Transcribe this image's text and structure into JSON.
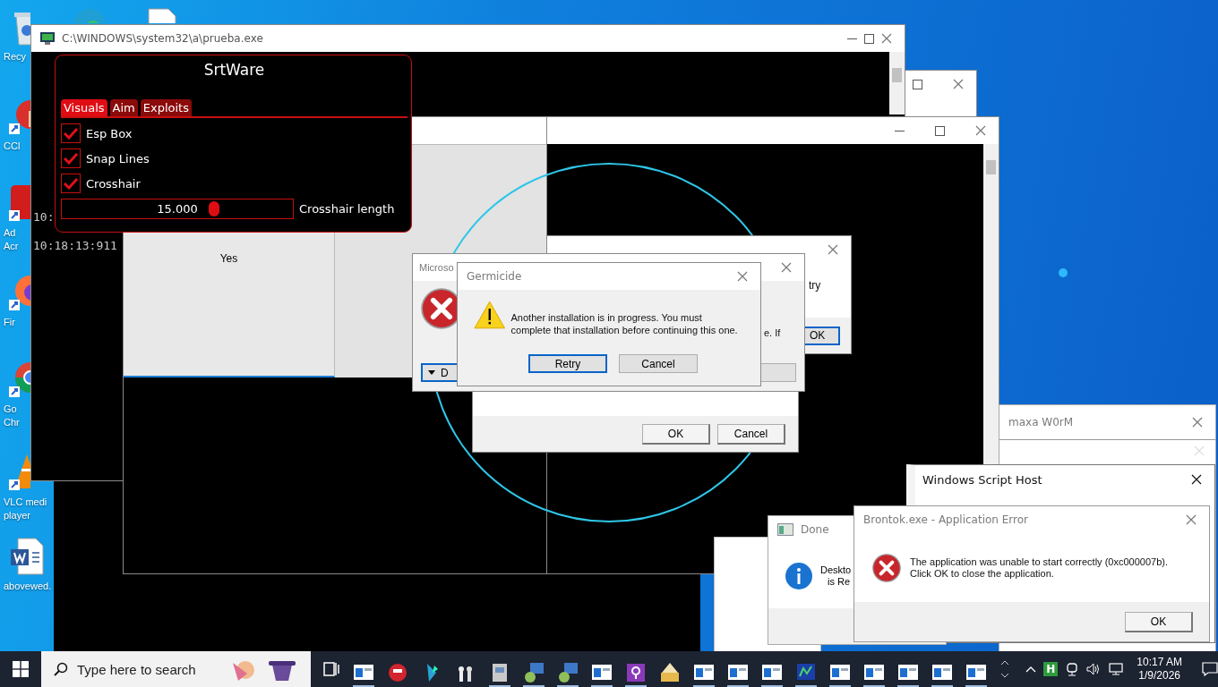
{
  "desktop_icons": [
    {
      "kind": "recycle",
      "lines": [
        "Recy"
      ]
    },
    {
      "kind": "edge"
    },
    {
      "kind": "document"
    },
    {
      "kind": "cleaner",
      "lines": [
        "CCl"
      ]
    },
    {
      "kind": "acrobat",
      "lines": [
        "Ad",
        "Acr"
      ]
    },
    {
      "kind": "firefox",
      "lines": [
        "Fir"
      ]
    },
    {
      "kind": "chrome",
      "lines": [
        "Go",
        "Chr"
      ]
    },
    {
      "kind": "vlc",
      "lines": [
        "VLC medi",
        "player"
      ]
    },
    {
      "kind": "word",
      "lines": [
        "abovewed."
      ]
    }
  ],
  "console": {
    "title": "C:\\WINDOWS\\system32\\a\\prueba.exe",
    "lines": [
      "10:",
      "10:18:13:911"
    ]
  },
  "srtware": {
    "title": "SrtWare",
    "tabs": [
      {
        "label": "Visuals",
        "selected": true
      },
      {
        "label": "Aim",
        "selected": false
      },
      {
        "label": "Exploits",
        "selected": false
      }
    ],
    "options": [
      {
        "label": "Esp Box",
        "checked": true
      },
      {
        "label": "Snap Lines",
        "checked": true
      },
      {
        "label": "Crosshair",
        "checked": true
      }
    ],
    "slider": {
      "value": "15.000",
      "level": 0.66,
      "label": "Crosshair length"
    }
  },
  "yes_window": {
    "button": "Yes"
  },
  "back_dialog": {
    "text_1": "try",
    "button": "OK"
  },
  "lower_dialog": {
    "buttons": [
      "OK",
      "Cancel"
    ]
  },
  "microsoft_dialog": {
    "title": "Microso",
    "text": "e. If",
    "dropdown": "D"
  },
  "germicide": {
    "title": "Germicide",
    "message": "Another installation is in progress. You must complete that installation before continuing this one.",
    "buttons": [
      {
        "label": "Retry",
        "selected": true
      },
      {
        "label": "Cancel",
        "selected": false
      }
    ]
  },
  "worm_window": {
    "title": "maxa W0rM"
  },
  "script_host": {
    "title": "Windows Script Host"
  },
  "done_dialog": {
    "title": "Done",
    "lines": [
      "Deskto",
      "is Re"
    ]
  },
  "brontok": {
    "title": "Brontok.exe - Application Error",
    "lines": [
      "The application was unable to start correctly (0xc000007b).",
      "Click OK to close the application."
    ],
    "button": "OK"
  },
  "taskbar": {
    "search_placeholder": "Type here to search",
    "tray_badge": "H",
    "time": "10:17 AM",
    "date": "1/9/2026"
  }
}
